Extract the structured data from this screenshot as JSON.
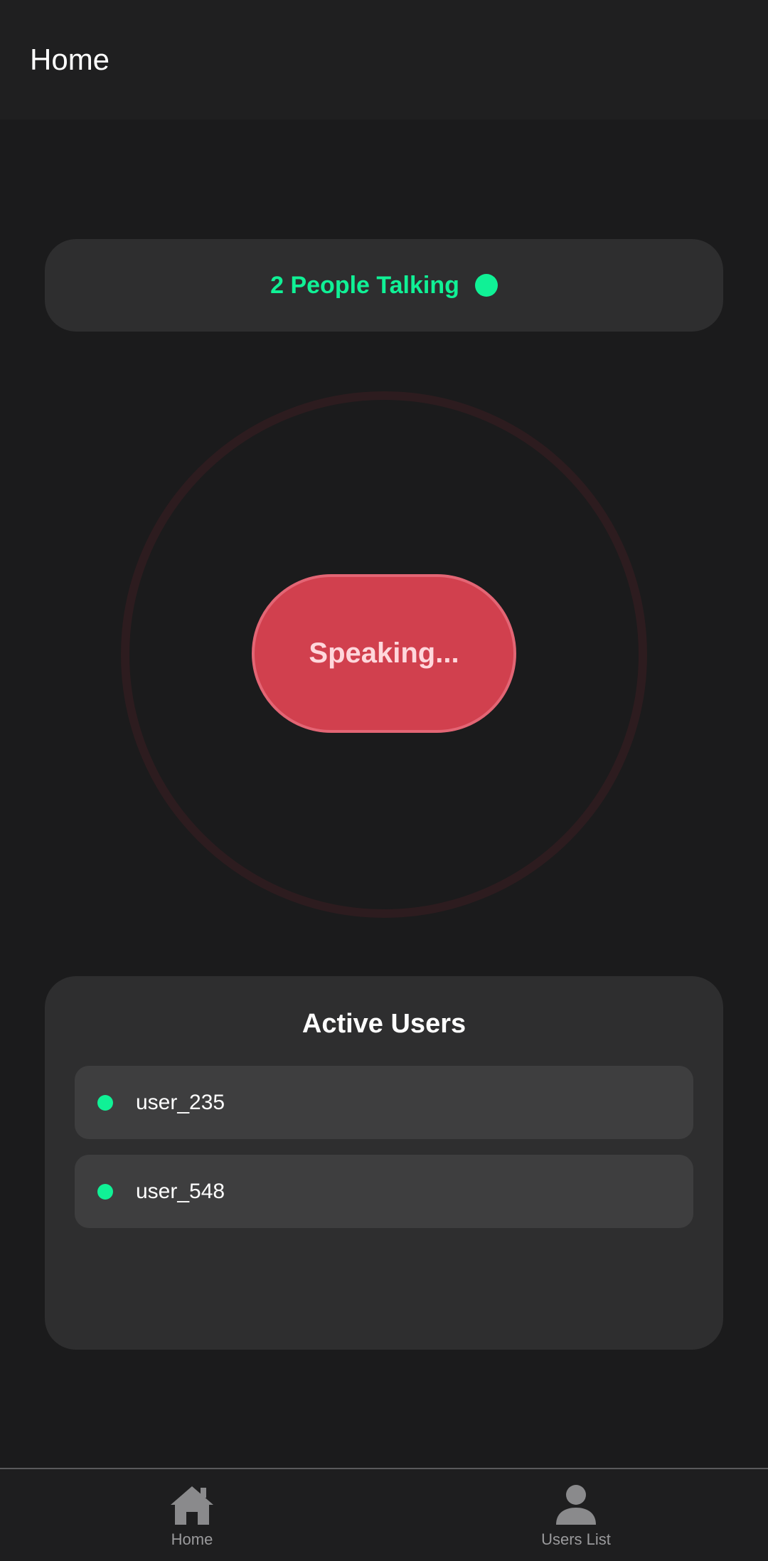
{
  "app_bar": {
    "title": "Home"
  },
  "status": {
    "text": "2 People Talking",
    "indicator_color": "#10f196"
  },
  "speak_button": {
    "label": "Speaking...",
    "color": "#d1404e"
  },
  "active_users": {
    "title": "Active Users",
    "users": [
      {
        "name": "user_235",
        "online": true
      },
      {
        "name": "user_548",
        "online": true
      }
    ]
  },
  "bottom_nav": {
    "items": [
      {
        "label": "Home",
        "icon": "home-icon"
      },
      {
        "label": "Users List",
        "icon": "person-icon"
      }
    ]
  },
  "colors": {
    "background": "#1b1b1c",
    "card": "#2e2e2f",
    "accent_green": "#10f196"
  }
}
